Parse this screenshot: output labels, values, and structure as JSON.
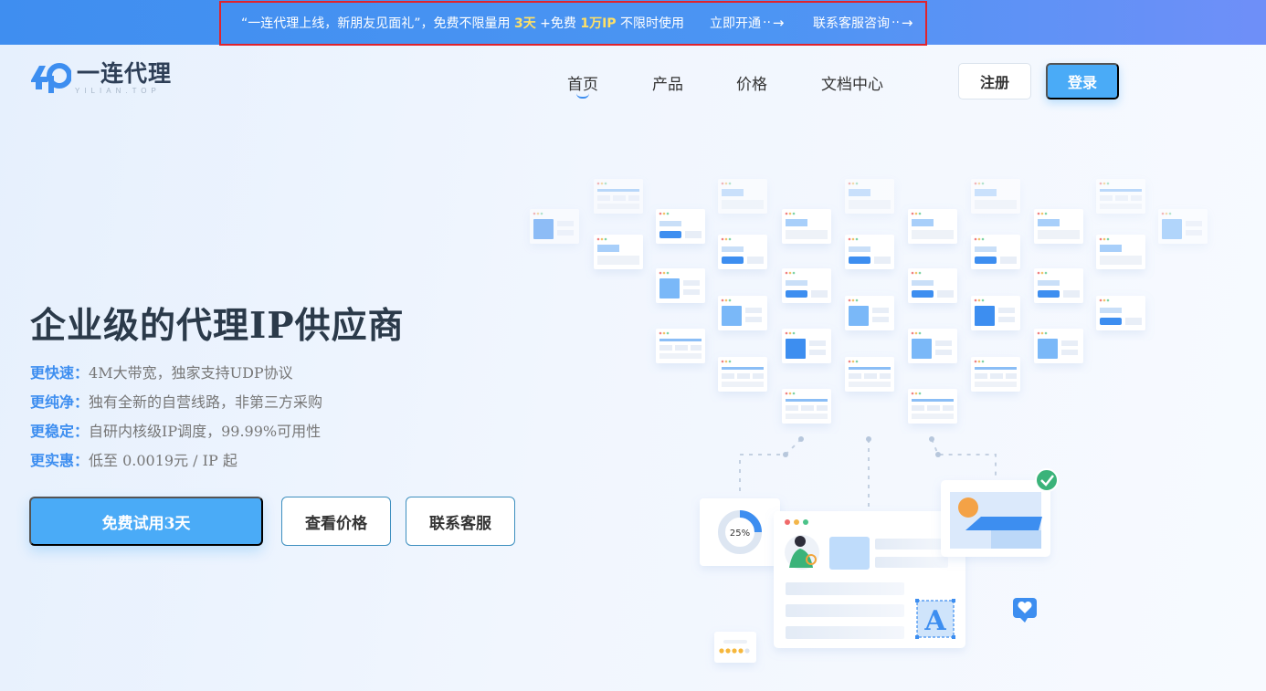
{
  "banner": {
    "promo_prefix": "“一连代理上线，新朋友见面礼”，免费不限量用",
    "promo_days": "3天",
    "promo_mid": "+免费",
    "promo_ips": "1万IP",
    "promo_suffix": "不限时使用",
    "link_activate": "立即开通",
    "link_contact": "联系客服咨询",
    "dots": "··",
    "arrow": "→"
  },
  "header": {
    "logo_text": "一连代理",
    "logo_sub": "YILIAN.TOP",
    "nav": [
      {
        "label": "首页",
        "active": true
      },
      {
        "label": "产品",
        "active": false
      },
      {
        "label": "价格",
        "active": false
      },
      {
        "label": "文档中心",
        "active": false
      }
    ],
    "register_label": "注册",
    "login_label": "登录"
  },
  "hero": {
    "title": "企业级的代理IP供应商",
    "features": [
      {
        "key": "更快速：",
        "value": "4M大带宽，独家支持UDP协议"
      },
      {
        "key": "更纯净：",
        "value": "独有全新的自营线路，非第三方采购"
      },
      {
        "key": "更稳定：",
        "value": "自研内核级IP调度，99.99%可用性"
      },
      {
        "key": "更实惠：",
        "value": "低至 0.0019元 / IP 起"
      }
    ],
    "cta_trial": "免费试用3天",
    "cta_pricing": "查看价格",
    "cta_contact": "联系客服"
  },
  "illustration": {
    "donut_label": "25%",
    "donut_percent": 25,
    "letter_tile": "A",
    "rating_stars": 4,
    "rating_max": 5
  },
  "colors": {
    "brand_blue": "#4aabf7",
    "banner_blue": "#3f8ef0",
    "highlight_yellow": "#ffe066",
    "title_dark": "#2b3a4a",
    "feature_key": "#3d8ef0"
  },
  "icons": [
    "arrow-right-icon",
    "logo-icon",
    "check-icon",
    "heart-icon",
    "star-icon",
    "avatar-icon"
  ]
}
